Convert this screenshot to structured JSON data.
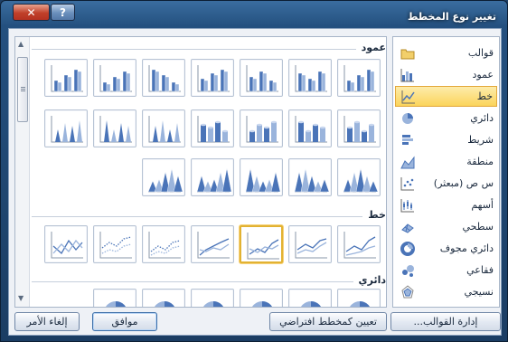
{
  "window": {
    "title": "تغيير نوع المخطط"
  },
  "titlebar": {
    "close_glyph": "✕",
    "help_glyph": "?"
  },
  "categories": [
    {
      "label": "قوالب",
      "icon": "folder-icon"
    },
    {
      "label": "عمود",
      "icon": "column-chart-icon"
    },
    {
      "label": "خط",
      "icon": "line-chart-icon",
      "selected": true
    },
    {
      "label": "دائري",
      "icon": "pie-chart-icon"
    },
    {
      "label": "شريط",
      "icon": "bar-chart-icon"
    },
    {
      "label": "منطقة",
      "icon": "area-chart-icon"
    },
    {
      "label": "س ص (مبعثر)",
      "icon": "scatter-chart-icon"
    },
    {
      "label": "أسهم",
      "icon": "stock-chart-icon"
    },
    {
      "label": "سطحي",
      "icon": "surface-chart-icon"
    },
    {
      "label": "دائري مجوف",
      "icon": "doughnut-chart-icon"
    },
    {
      "label": "فقاعي",
      "icon": "bubble-chart-icon"
    },
    {
      "label": "نسيجي",
      "icon": "radar-chart-icon"
    }
  ],
  "gallery": {
    "sections": [
      {
        "title": "عمود"
      },
      {
        "title": "خط"
      },
      {
        "title": "دائري"
      }
    ],
    "selected_chart": "line"
  },
  "buttons": {
    "manage_templates": "إدارة القوالب...",
    "set_default": "تعيين كمخطط افتراضي",
    "ok": "موافق",
    "cancel": "إلغاء الأمر"
  },
  "colors": {
    "accent_blue": "#4a74b8",
    "accent_light": "#9ab4dc",
    "selection_gold": "#e2b232"
  }
}
